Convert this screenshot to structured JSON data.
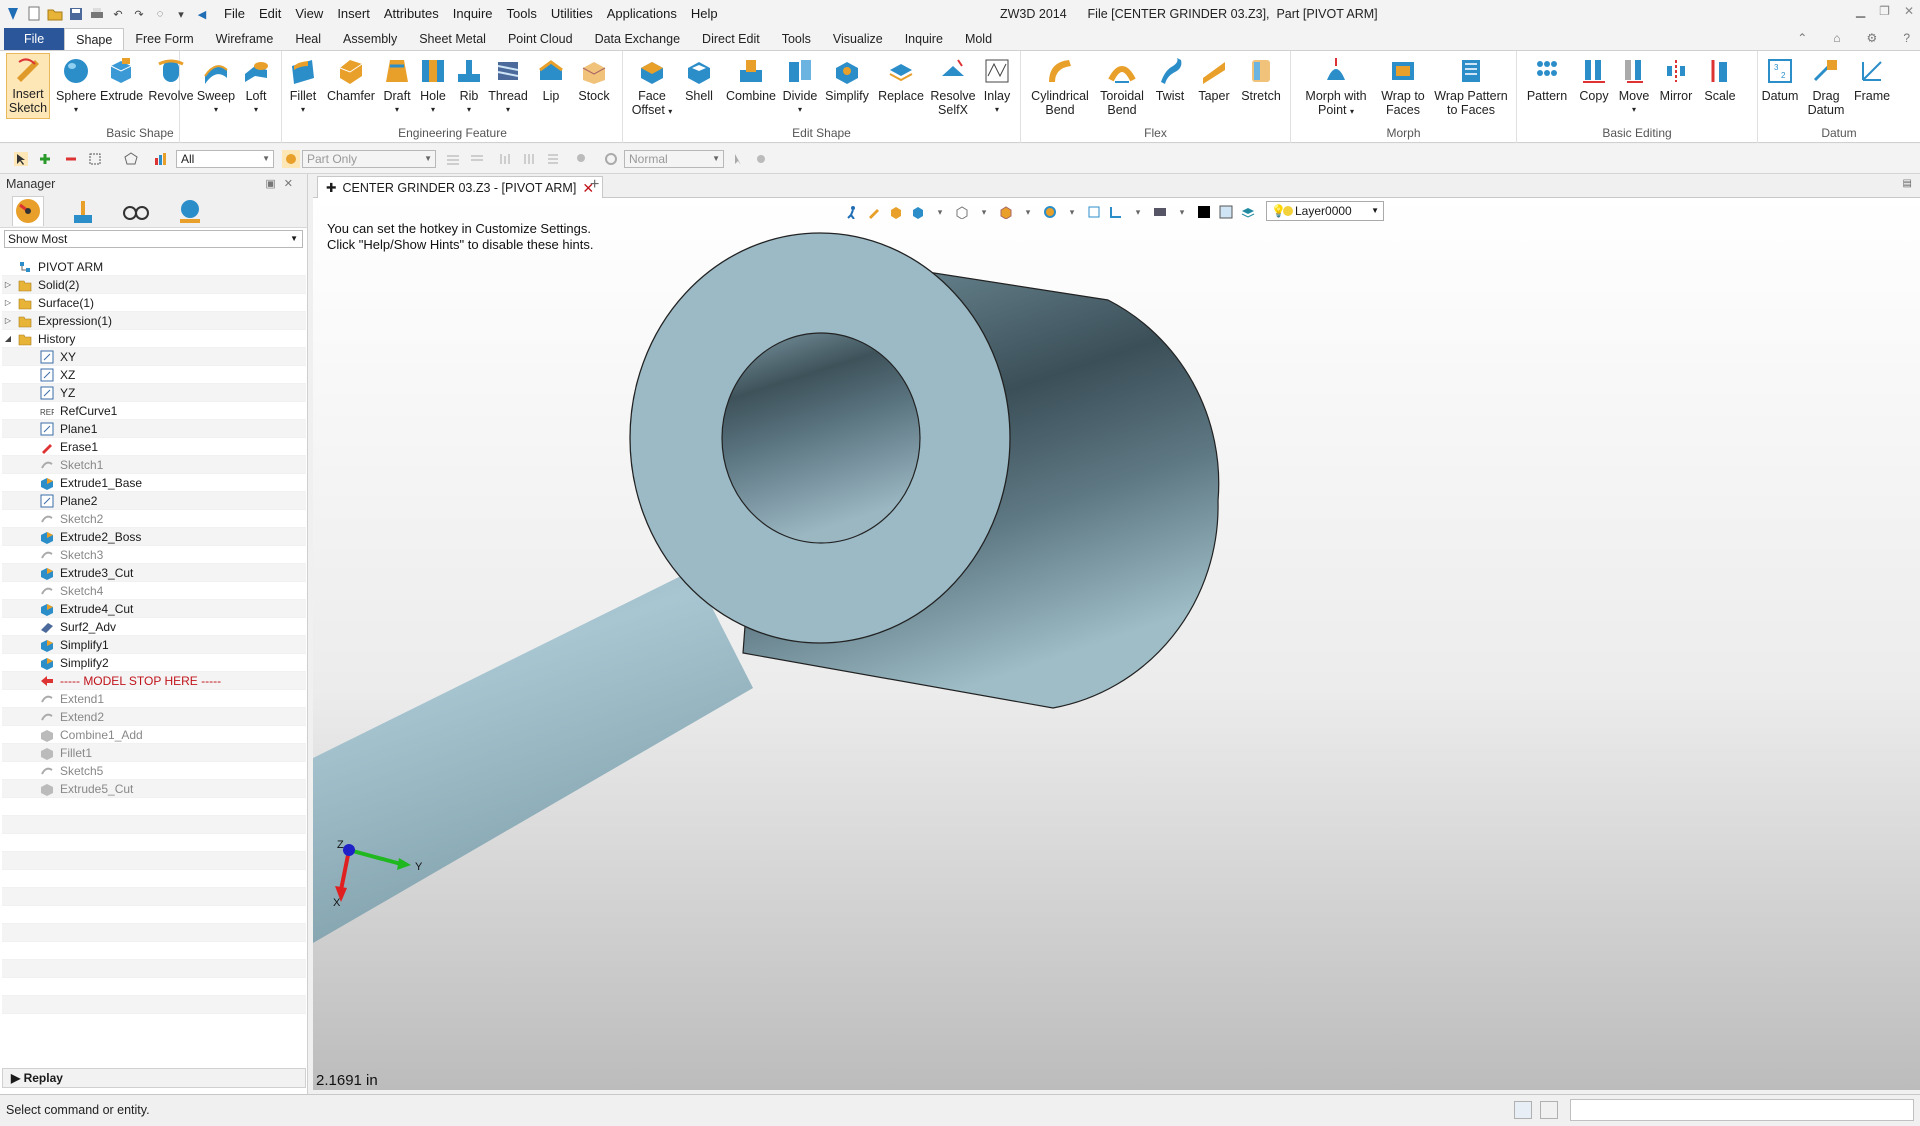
{
  "titlebar": {
    "menu": [
      "File",
      "Edit",
      "View",
      "Insert",
      "Attributes",
      "Inquire",
      "Tools",
      "Utilities",
      "Applications",
      "Help"
    ],
    "app_name": "ZW3D 2014",
    "file_info": "File [CENTER GRINDER 03.Z3],  Part [PIVOT ARM]"
  },
  "ribbon_tabs": [
    "File",
    "Shape",
    "Free Form",
    "Wireframe",
    "Heal",
    "Assembly",
    "Sheet Metal",
    "Point Cloud",
    "Data Exchange",
    "Direct Edit",
    "Tools",
    "Visualize",
    "Inquire",
    "Mold"
  ],
  "ribbon_active_tab": "Shape",
  "ribbon": {
    "basic_shape": {
      "name": "Basic Shape",
      "buttons": [
        "Insert\nSketch",
        "Sphere",
        "Extrude",
        "Revolve",
        "Sweep",
        "Loft"
      ]
    },
    "engineering": {
      "name": "Engineering Feature",
      "buttons": [
        "Fillet",
        "Chamfer",
        "Draft",
        "Hole",
        "Rib",
        "Thread",
        "Lip",
        "Stock"
      ]
    },
    "edit_shape": {
      "name": "Edit Shape",
      "buttons": [
        "Face\nOffset",
        "Shell",
        "Combine",
        "Divide",
        "Simplify",
        "Replace",
        "Resolve\nSelfX",
        "Inlay"
      ]
    },
    "flex": {
      "name": "Flex",
      "buttons": [
        "Cylindrical\nBend",
        "Toroidal\nBend",
        "Twist",
        "Taper",
        "Stretch"
      ]
    },
    "morph": {
      "name": "Morph",
      "buttons": [
        "Morph with\nPoint",
        "Wrap to\nFaces",
        "Wrap Pattern\nto Faces"
      ]
    },
    "basic_editing": {
      "name": "Basic Editing",
      "buttons": [
        "Pattern",
        "Copy",
        "Move",
        "Mirror",
        "Scale"
      ]
    },
    "datum": {
      "name": "Datum",
      "buttons": [
        "Datum",
        "Drag\nDatum",
        "Frame"
      ]
    }
  },
  "toolbar2": {
    "filter": "All",
    "pick": "Part Only",
    "mode": "Normal"
  },
  "manager": {
    "title": "Manager",
    "filter": "Show Most",
    "root": "PIVOT ARM",
    "folders": [
      "Solid(2)",
      "Surface(1)",
      "Expression(1)",
      "History"
    ],
    "history": [
      {
        "label": "XY",
        "type": "datum",
        "state": "normal"
      },
      {
        "label": "XZ",
        "type": "datum",
        "state": "normal"
      },
      {
        "label": "YZ",
        "type": "datum",
        "state": "normal"
      },
      {
        "label": "RefCurve1",
        "type": "ref",
        "state": "normal"
      },
      {
        "label": "Plane1",
        "type": "datum",
        "state": "normal"
      },
      {
        "label": "Erase1",
        "type": "erase",
        "state": "normal"
      },
      {
        "label": "Sketch1",
        "type": "sketch",
        "state": "suppressed"
      },
      {
        "label": "Extrude1_Base",
        "type": "solid",
        "state": "normal"
      },
      {
        "label": "Plane2",
        "type": "datum",
        "state": "normal"
      },
      {
        "label": "Sketch2",
        "type": "sketch",
        "state": "suppressed"
      },
      {
        "label": "Extrude2_Boss",
        "type": "solid",
        "state": "normal"
      },
      {
        "label": "Sketch3",
        "type": "sketch",
        "state": "suppressed"
      },
      {
        "label": "Extrude3_Cut",
        "type": "solid",
        "state": "normal"
      },
      {
        "label": "Sketch4",
        "type": "sketch",
        "state": "suppressed"
      },
      {
        "label": "Extrude4_Cut",
        "type": "solid",
        "state": "normal"
      },
      {
        "label": "Surf2_Adv",
        "type": "surface",
        "state": "normal"
      },
      {
        "label": "Simplify1",
        "type": "solid",
        "state": "normal"
      },
      {
        "label": "Simplify2",
        "type": "solid",
        "state": "normal"
      },
      {
        "label": "----- MODEL STOP HERE -----",
        "type": "stop",
        "state": "stop"
      },
      {
        "label": "Extend1",
        "type": "sketch",
        "state": "suppressed"
      },
      {
        "label": "Extend2",
        "type": "sketch",
        "state": "suppressed"
      },
      {
        "label": "Combine1_Add",
        "type": "grey",
        "state": "suppressed"
      },
      {
        "label": "Fillet1",
        "type": "grey",
        "state": "suppressed"
      },
      {
        "label": "Sketch5",
        "type": "sketch",
        "state": "suppressed"
      },
      {
        "label": "Extrude5_Cut",
        "type": "grey",
        "state": "suppressed"
      }
    ],
    "replay": "Replay"
  },
  "document_tab": "CENTER GRINDER 03.Z3 - [PIVOT ARM]",
  "viewport": {
    "hint_line1": "You can set the hotkey in Customize Settings.",
    "hint_line2": "Click \"Help/Show Hints\" to disable these hints.",
    "layer": "Layer0000",
    "scale": "2.1691 in",
    "axes": {
      "x": "X",
      "y": "Y",
      "z": "Z"
    }
  },
  "status": "Select command or entity.",
  "colors": {
    "model_face": "#9bbac6",
    "model_dark": "#3a4d55",
    "accent": "#2b579a",
    "stop": "#c0141b"
  }
}
